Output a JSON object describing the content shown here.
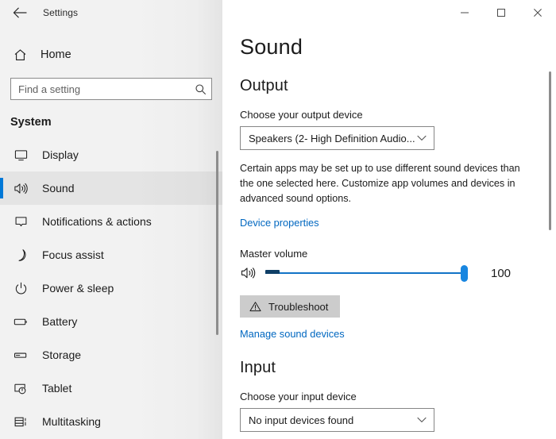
{
  "accent_color": "#0078d7",
  "link_color": "#0067c0",
  "titlebar": {
    "back_label": "back-arrow",
    "app_title": "Settings",
    "minimize": "minimize",
    "maximize": "maximize",
    "close": "close"
  },
  "sidebar": {
    "home_label": "Home",
    "search": {
      "placeholder": "Find a setting",
      "value": ""
    },
    "section_title": "System",
    "items": [
      {
        "label": "Display",
        "icon": "monitor-icon",
        "selected": false
      },
      {
        "label": "Sound",
        "icon": "speaker-icon",
        "selected": true
      },
      {
        "label": "Notifications & actions",
        "icon": "notification-icon",
        "selected": false
      },
      {
        "label": "Focus assist",
        "icon": "moon-icon",
        "selected": false
      },
      {
        "label": "Power & sleep",
        "icon": "power-icon",
        "selected": false
      },
      {
        "label": "Battery",
        "icon": "battery-icon",
        "selected": false
      },
      {
        "label": "Storage",
        "icon": "storage-icon",
        "selected": false
      },
      {
        "label": "Tablet",
        "icon": "tablet-icon",
        "selected": false
      },
      {
        "label": "Multitasking",
        "icon": "multitasking-icon",
        "selected": false
      }
    ]
  },
  "main": {
    "page_title": "Sound",
    "output": {
      "group_title": "Output",
      "device_label": "Choose your output device",
      "device_value": "Speakers (2- High Definition Audio...",
      "description": "Certain apps may be set up to use different sound devices than the one selected here. Customize app volumes and devices in advanced sound options.",
      "device_properties_link": "Device properties",
      "volume_label": "Master volume",
      "volume_value": "100",
      "volume_percent": 100,
      "troubleshoot_label": "Troubleshoot",
      "manage_link": "Manage sound devices"
    },
    "input": {
      "group_title": "Input",
      "device_label": "Choose your input device",
      "device_value": "No input devices found"
    }
  }
}
